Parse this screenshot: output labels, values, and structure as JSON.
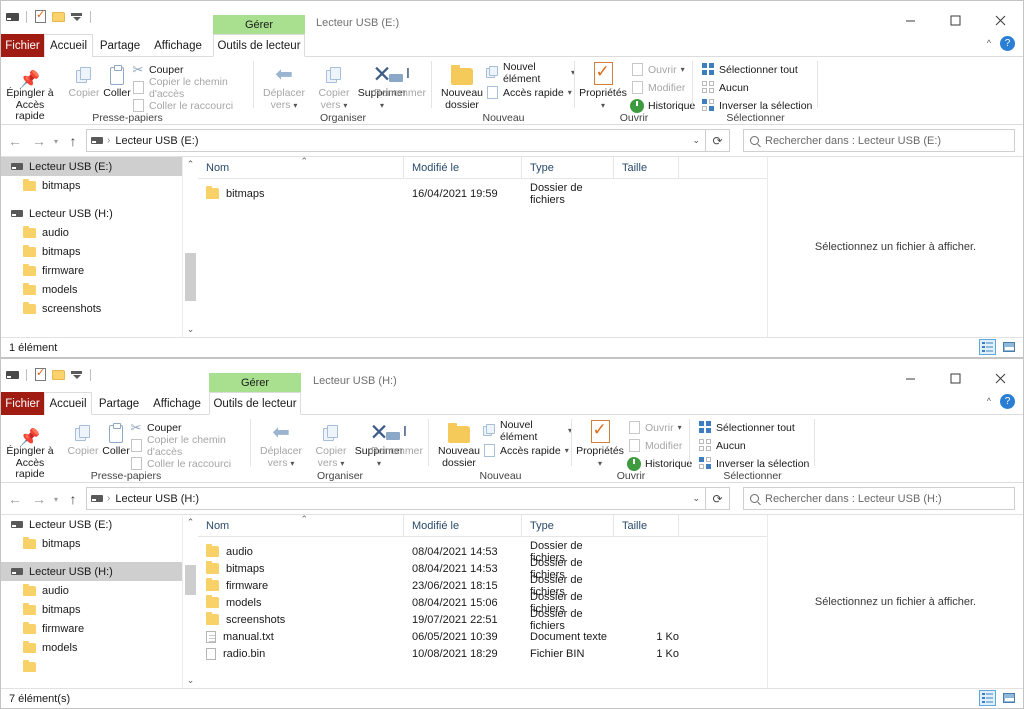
{
  "windows": [
    {
      "title": "Lecteur USB (E:)",
      "context_tab_group": "Gérer",
      "context_tab": "Outils de lecteur",
      "tabs": [
        "Fichier",
        "Accueil",
        "Partage",
        "Affichage"
      ],
      "address": "Lecteur USB (E:)",
      "search_placeholder": "Rechercher dans : Lecteur USB (E:)",
      "preview_message": "Sélectionnez un fichier à afficher.",
      "status": "1 élément",
      "columns": [
        "Nom",
        "Modifié le",
        "Type",
        "Taille"
      ],
      "files": [
        {
          "name": "bitmaps",
          "modified": "16/04/2021 19:59",
          "type": "Dossier de fichiers",
          "size": "",
          "icon": "folder-icon"
        }
      ],
      "nav": [
        {
          "label": "Lecteur USB (E:)",
          "level": "root",
          "icon": "drive-icon",
          "selected": true
        },
        {
          "label": "bitmaps",
          "level": "child",
          "icon": "folder-icon",
          "selected": false
        },
        {
          "label": "",
          "level": "gap",
          "icon": "",
          "selected": false
        },
        {
          "label": "Lecteur USB (H:)",
          "level": "root",
          "icon": "drive-icon",
          "selected": false
        },
        {
          "label": "audio",
          "level": "child",
          "icon": "folder-icon",
          "selected": false
        },
        {
          "label": "bitmaps",
          "level": "child",
          "icon": "folder-icon",
          "selected": false
        },
        {
          "label": "firmware",
          "level": "child",
          "icon": "folder-icon",
          "selected": false
        },
        {
          "label": "models",
          "level": "child",
          "icon": "folder-icon",
          "selected": false
        },
        {
          "label": "screenshots",
          "level": "child",
          "icon": "folder-icon",
          "selected": false
        }
      ]
    },
    {
      "title": "Lecteur USB (H:)",
      "context_tab_group": "Gérer",
      "context_tab": "Outils de lecteur",
      "tabs": [
        "Fichier",
        "Accueil",
        "Partage",
        "Affichage"
      ],
      "address": "Lecteur USB (H:)",
      "search_placeholder": "Rechercher dans : Lecteur USB (H:)",
      "preview_message": "Sélectionnez un fichier à afficher.",
      "status": "7 élément(s)",
      "columns": [
        "Nom",
        "Modifié le",
        "Type",
        "Taille"
      ],
      "files": [
        {
          "name": "audio",
          "modified": "08/04/2021 14:53",
          "type": "Dossier de fichiers",
          "size": "",
          "icon": "folder-icon"
        },
        {
          "name": "bitmaps",
          "modified": "08/04/2021 14:53",
          "type": "Dossier de fichiers",
          "size": "",
          "icon": "folder-icon"
        },
        {
          "name": "firmware",
          "modified": "23/06/2021 18:15",
          "type": "Dossier de fichiers",
          "size": "",
          "icon": "folder-icon"
        },
        {
          "name": "models",
          "modified": "08/04/2021 15:06",
          "type": "Dossier de fichiers",
          "size": "",
          "icon": "folder-icon"
        },
        {
          "name": "screenshots",
          "modified": "19/07/2021 22:51",
          "type": "Dossier de fichiers",
          "size": "",
          "icon": "folder-icon"
        },
        {
          "name": "manual.txt",
          "modified": "06/05/2021 10:39",
          "type": "Document texte",
          "size": "1 Ko",
          "icon": "text-document-icon"
        },
        {
          "name": "radio.bin",
          "modified": "10/08/2021 18:29",
          "type": "Fichier BIN",
          "size": "1 Ko",
          "icon": "binary-file-icon"
        }
      ],
      "nav": [
        {
          "label": "Lecteur USB (E:)",
          "level": "root",
          "icon": "drive-icon",
          "selected": false
        },
        {
          "label": "bitmaps",
          "level": "child",
          "icon": "folder-icon",
          "selected": false
        },
        {
          "label": "",
          "level": "gap",
          "icon": "",
          "selected": false
        },
        {
          "label": "Lecteur USB (H:)",
          "level": "root",
          "icon": "drive-icon",
          "selected": true
        },
        {
          "label": "audio",
          "level": "child",
          "icon": "folder-icon",
          "selected": false
        },
        {
          "label": "bitmaps",
          "level": "child",
          "icon": "folder-icon",
          "selected": false
        },
        {
          "label": "firmware",
          "level": "child",
          "icon": "folder-icon",
          "selected": false
        },
        {
          "label": "models",
          "level": "child",
          "icon": "folder-icon",
          "selected": false
        }
      ]
    }
  ],
  "ribbon": {
    "groups": [
      {
        "name": "Presse-papiers"
      },
      {
        "name": "Organiser"
      },
      {
        "name": "Nouveau"
      },
      {
        "name": "Ouvrir"
      },
      {
        "name": "Sélectionner"
      }
    ],
    "clipboard": {
      "pin": "Épingler à Accès rapide",
      "pin_l1": "Épingler à",
      "pin_l2": "Accès rapide",
      "copy": "Copier",
      "paste": "Coller",
      "cut": "Couper",
      "copy_path": "Copier le chemin d'accès",
      "paste_shortcut": "Coller le raccourci"
    },
    "organize": {
      "move_to_l1": "Déplacer",
      "move_to_l2": "vers",
      "copy_to_l1": "Copier",
      "copy_to_l2": "vers",
      "delete": "Supprimer",
      "rename": "Renommer"
    },
    "new": {
      "new_folder_l1": "Nouveau",
      "new_folder_l2": "dossier",
      "new_item": "Nouvel élément",
      "quick_access": "Accès rapide"
    },
    "open": {
      "properties": "Propriétés",
      "open": "Ouvrir",
      "edit": "Modifier",
      "history": "Historique"
    },
    "select": {
      "select_all": "Sélectionner tout",
      "select_none": "Aucun",
      "invert": "Inverser la sélection"
    }
  },
  "icons": {
    "minimize": "minimize-icon",
    "maximize": "maximize-icon",
    "close": "close-icon",
    "help": "help-icon",
    "collapse_ribbon": "collapse-ribbon-icon",
    "back": "back-arrow-icon",
    "forward": "forward-arrow-icon",
    "recent": "recent-locations-icon",
    "up": "up-arrow-icon",
    "refresh": "refresh-icon",
    "search": "search-icon"
  },
  "colors": {
    "file_tab": "#a01b12",
    "context_tab": "#a8e08f",
    "selection": "#cfcfcf",
    "help_blue": "#2a7fd4",
    "folder_yellow": "#f8d268"
  }
}
